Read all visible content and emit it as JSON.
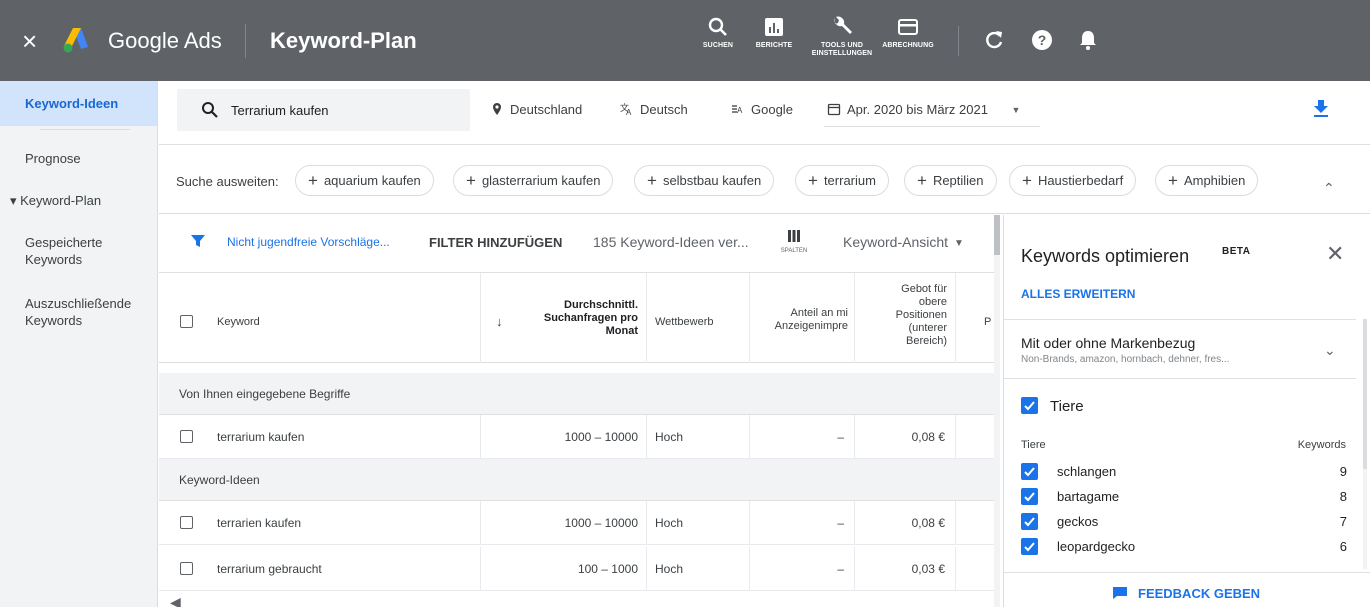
{
  "topbar": {
    "app_name": "Google Ads",
    "page_title": "Keyword-Plan",
    "tools": [
      {
        "label": "SUCHEN",
        "icon": "search-icon"
      },
      {
        "label": "BERICHTE",
        "icon": "reports-icon"
      },
      {
        "label1": "TOOLS UND",
        "label2": "EINSTELLUNGEN",
        "icon": "wrench-icon"
      },
      {
        "label": "ABRECHNUNG",
        "icon": "billing-icon"
      }
    ]
  },
  "leftnav": {
    "items": [
      {
        "label": "Keyword-Ideen",
        "active": true
      },
      {
        "label": "Prognose"
      },
      {
        "label": "▾ Keyword-Plan"
      },
      {
        "label1": "Gespeicherte",
        "label2": "Keywords"
      },
      {
        "label1": "Auszuschließende",
        "label2": "Keywords"
      }
    ]
  },
  "search": {
    "value": "Terrarium kaufen",
    "location": "Deutschland",
    "language": "Deutsch",
    "network": "Google",
    "date_range": "Apr. 2020 bis März 2021"
  },
  "expand": {
    "label": "Suche ausweiten:",
    "chips": [
      "aquarium kaufen",
      "glasterrarium kaufen",
      "selbstbau kaufen",
      "terrarium",
      "Reptilien",
      "Haustierbedarf",
      "Amphibien"
    ]
  },
  "toolbar": {
    "filter_link": "Nicht jugendfreie Vorschläge...",
    "add_filter": "FILTER HINZUFÜGEN",
    "count": "185 Keyword-Ideen ver...",
    "columns_label": "SPALTEN",
    "view": "Keyword-Ansicht"
  },
  "table": {
    "headers": {
      "keyword": "Keyword",
      "sort": "↓",
      "avg1": "Durchschnittl.",
      "avg2": "Suchanfragen pro",
      "avg3": "Monat",
      "competition": "Wettbewerb",
      "share1": "Anteil an mi",
      "share2": "Anzeigenimpre",
      "bid1": "Gebot für",
      "bid2": "obere",
      "bid3": "Positionen",
      "bid4": "(unterer",
      "bid5": "Bereich)",
      "next": "P"
    },
    "group1": "Von Ihnen eingegebene Begriffe",
    "group2": "Keyword-Ideen",
    "rows": [
      {
        "keyword": "terrarium kaufen",
        "avg": "1000 – 10000",
        "competition": "Hoch",
        "share": "–",
        "bid": "0,08 €"
      },
      {
        "keyword": "terrarien kaufen",
        "avg": "1000 – 10000",
        "competition": "Hoch",
        "share": "–",
        "bid": "0,08 €"
      },
      {
        "keyword": "terrarium gebraucht",
        "avg": "100 – 1000",
        "competition": "Hoch",
        "share": "–",
        "bid": "0,03 €"
      }
    ]
  },
  "panel": {
    "title": "Keywords optimieren",
    "beta": "BETA",
    "expand_all": "ALLES ERWEITERN",
    "section1_title": "Mit oder ohne Markenbezug",
    "section1_sub": "Non-Brands, amazon, hornbach, dehner, fres...",
    "section2_title": "Tiere",
    "col_left": "Tiere",
    "col_right": "Keywords",
    "keywords": [
      {
        "name": "schlangen",
        "count": "9"
      },
      {
        "name": "bartagame",
        "count": "8"
      },
      {
        "name": "geckos",
        "count": "7"
      },
      {
        "name": "leopardgecko",
        "count": "6"
      }
    ],
    "feedback": "FEEDBACK GEBEN"
  },
  "colors": {
    "topbar_bg": "#5f6368",
    "accent": "#1a73e8",
    "nav_active_bg": "#d2e3fc"
  }
}
